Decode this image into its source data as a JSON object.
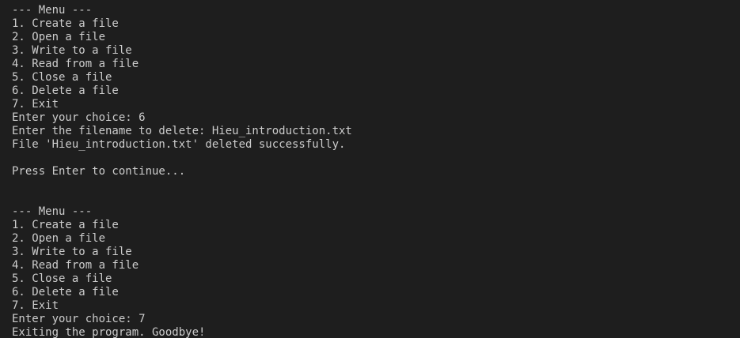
{
  "terminal": {
    "lines": [
      "--- Menu ---",
      "1. Create a file",
      "2. Open a file",
      "3. Write to a file",
      "4. Read from a file",
      "5. Close a file",
      "6. Delete a file",
      "7. Exit",
      "Enter your choice: 6",
      "Enter the filename to delete: Hieu_introduction.txt",
      "File 'Hieu_introduction.txt' deleted successfully.",
      "",
      "Press Enter to continue...",
      "",
      "",
      "--- Menu ---",
      "1. Create a file",
      "2. Open a file",
      "3. Write to a file",
      "4. Read from a file",
      "5. Close a file",
      "6. Delete a file",
      "7. Exit",
      "Enter your choice: 7",
      "Exiting the program. Goodbye!"
    ]
  }
}
